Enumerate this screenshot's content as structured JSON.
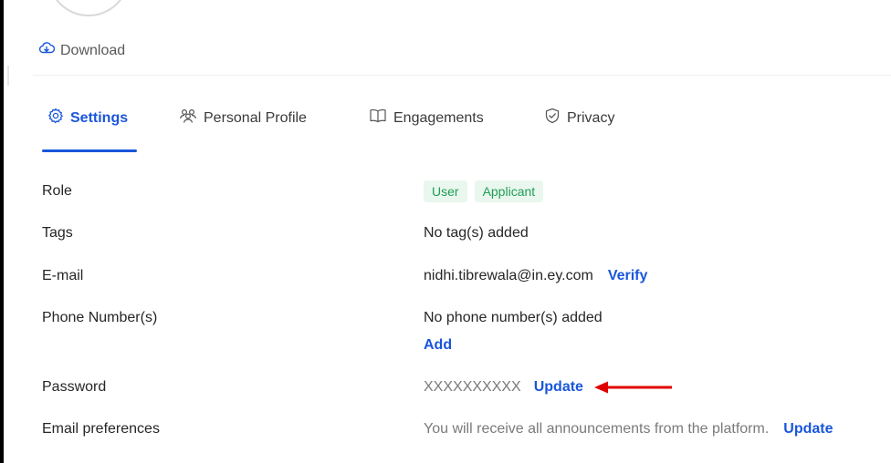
{
  "download": {
    "label": "Download"
  },
  "tabs": [
    {
      "label": "Settings",
      "icon": "gear-icon",
      "active": true
    },
    {
      "label": "Personal Profile",
      "icon": "users-icon",
      "active": false
    },
    {
      "label": "Engagements",
      "icon": "book-icon",
      "active": false
    },
    {
      "label": "Privacy",
      "icon": "shield-check-icon",
      "active": false
    }
  ],
  "settings": {
    "role": {
      "label": "Role",
      "tags": [
        "User",
        "Applicant"
      ]
    },
    "tags": {
      "label": "Tags",
      "value": "No tag(s) added"
    },
    "email": {
      "label": "E-mail",
      "value": "nidhi.tibrewala@in.ey.com",
      "action": "Verify"
    },
    "phone": {
      "label": "Phone Number(s)",
      "value": "No phone number(s) added",
      "action": "Add"
    },
    "password": {
      "label": "Password",
      "value": "XXXXXXXXXX",
      "action": "Update"
    },
    "email_prefs": {
      "label": "Email preferences",
      "value": "You will receive all announcements from the platform.",
      "action": "Update"
    }
  },
  "colors": {
    "accent": "#1a56db",
    "tag_bg": "#eaf7ee",
    "tag_text": "#1f9d55",
    "annotation_arrow": "#e00000"
  }
}
